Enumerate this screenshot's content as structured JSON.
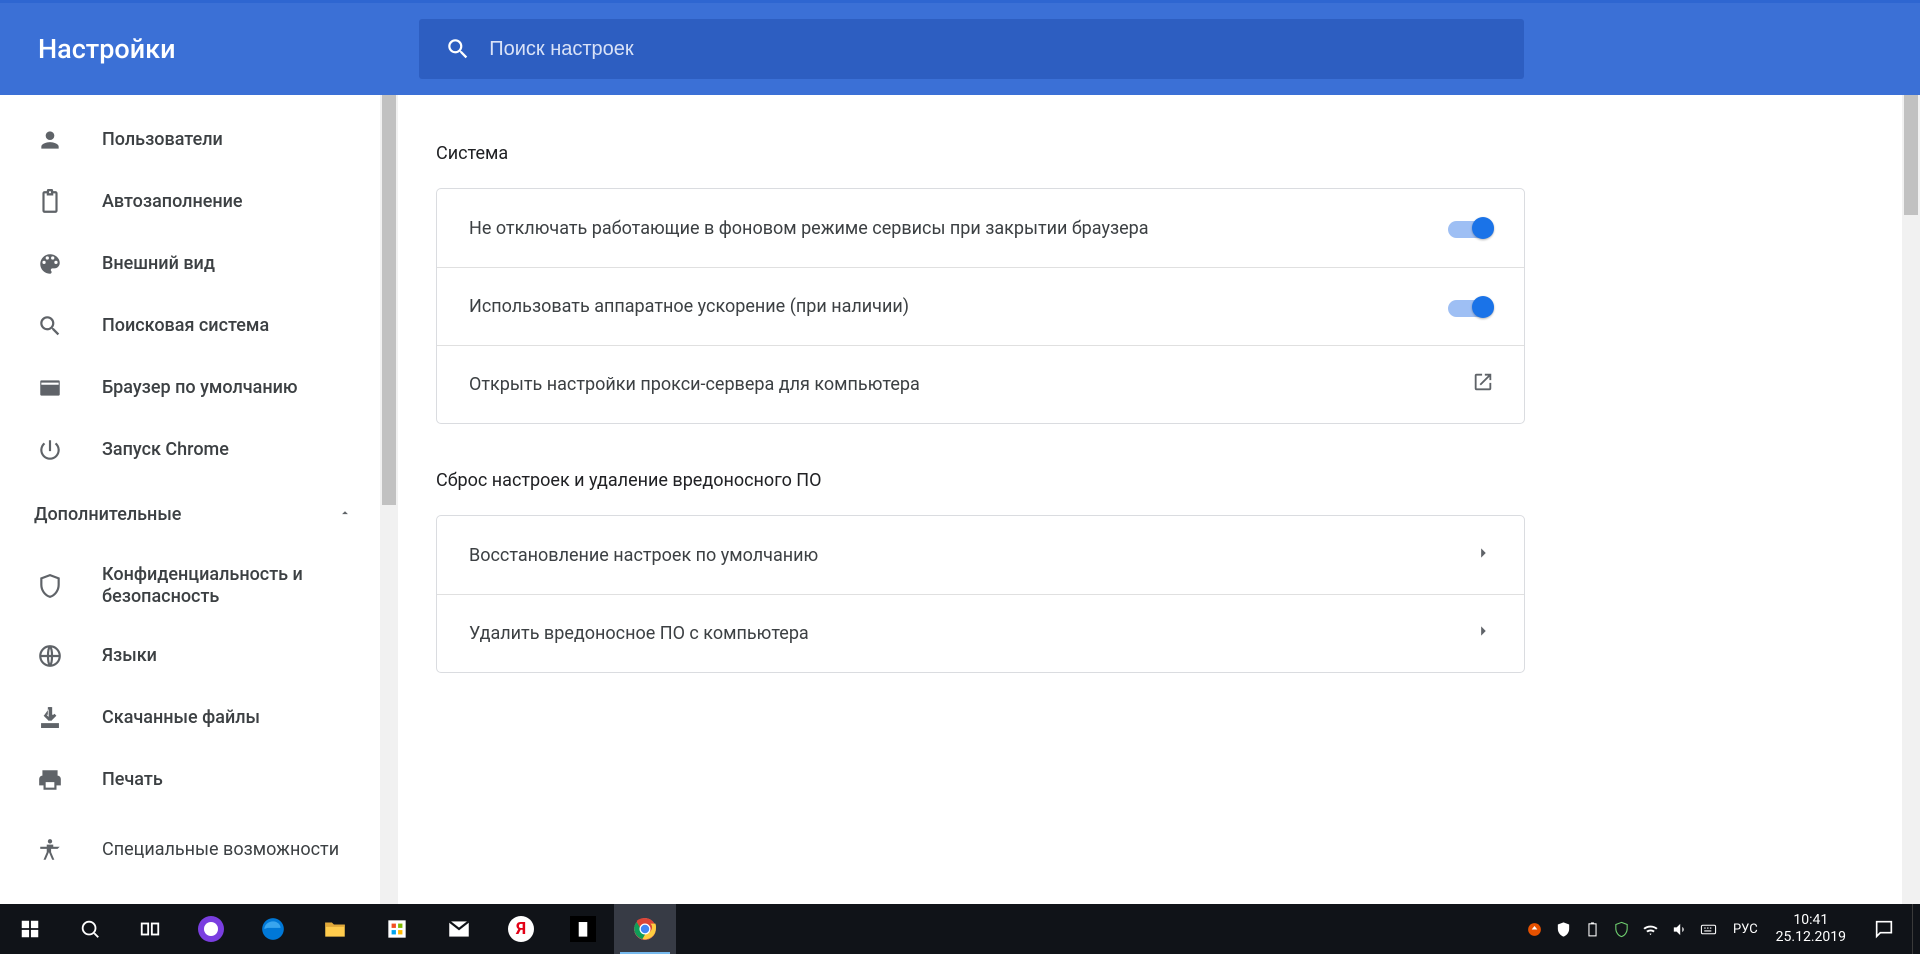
{
  "header": {
    "title": "Настройки",
    "search_placeholder": "Поиск настроек"
  },
  "sidebar": {
    "items": [
      {
        "id": "users",
        "label": "Пользователи",
        "icon": "person"
      },
      {
        "id": "autofill",
        "label": "Автозаполнение",
        "icon": "clipboard"
      },
      {
        "id": "appearance",
        "label": "Внешний вид",
        "icon": "palette"
      },
      {
        "id": "search-engine",
        "label": "Поисковая система",
        "icon": "search"
      },
      {
        "id": "default-browser",
        "label": "Браузер по умолчанию",
        "icon": "browser"
      },
      {
        "id": "on-startup",
        "label": "Запуск Chrome",
        "icon": "power"
      }
    ],
    "advanced_label": "Дополнительные",
    "advanced_items": [
      {
        "id": "privacy",
        "label": "Конфиденциальность и безопасность",
        "icon": "shield"
      },
      {
        "id": "languages",
        "label": "Языки",
        "icon": "globe"
      },
      {
        "id": "downloads",
        "label": "Скачанные файлы",
        "icon": "download"
      },
      {
        "id": "printing",
        "label": "Печать",
        "icon": "print"
      },
      {
        "id": "accessibility",
        "label": "Специальные возможности",
        "icon": "accessibility"
      }
    ]
  },
  "main": {
    "system": {
      "title": "Система",
      "rows": [
        {
          "label": "Не отключать работающие в фоновом режиме сервисы при закрытии браузера",
          "type": "toggle",
          "on": true
        },
        {
          "label": "Использовать аппаратное ускорение (при наличии)",
          "type": "toggle",
          "on": true
        },
        {
          "label": "Открыть настройки прокси-сервера для компьютера",
          "type": "external"
        }
      ]
    },
    "reset": {
      "title": "Сброс настроек и удаление вредоносного ПО",
      "rows": [
        {
          "label": "Восстановление настроек по умолчанию",
          "type": "link"
        },
        {
          "label": "Удалить вредоносное ПО с компьютера",
          "type": "link"
        }
      ]
    }
  },
  "taskbar": {
    "lang": "РУС",
    "time": "10:41",
    "date": "25.12.2019"
  }
}
